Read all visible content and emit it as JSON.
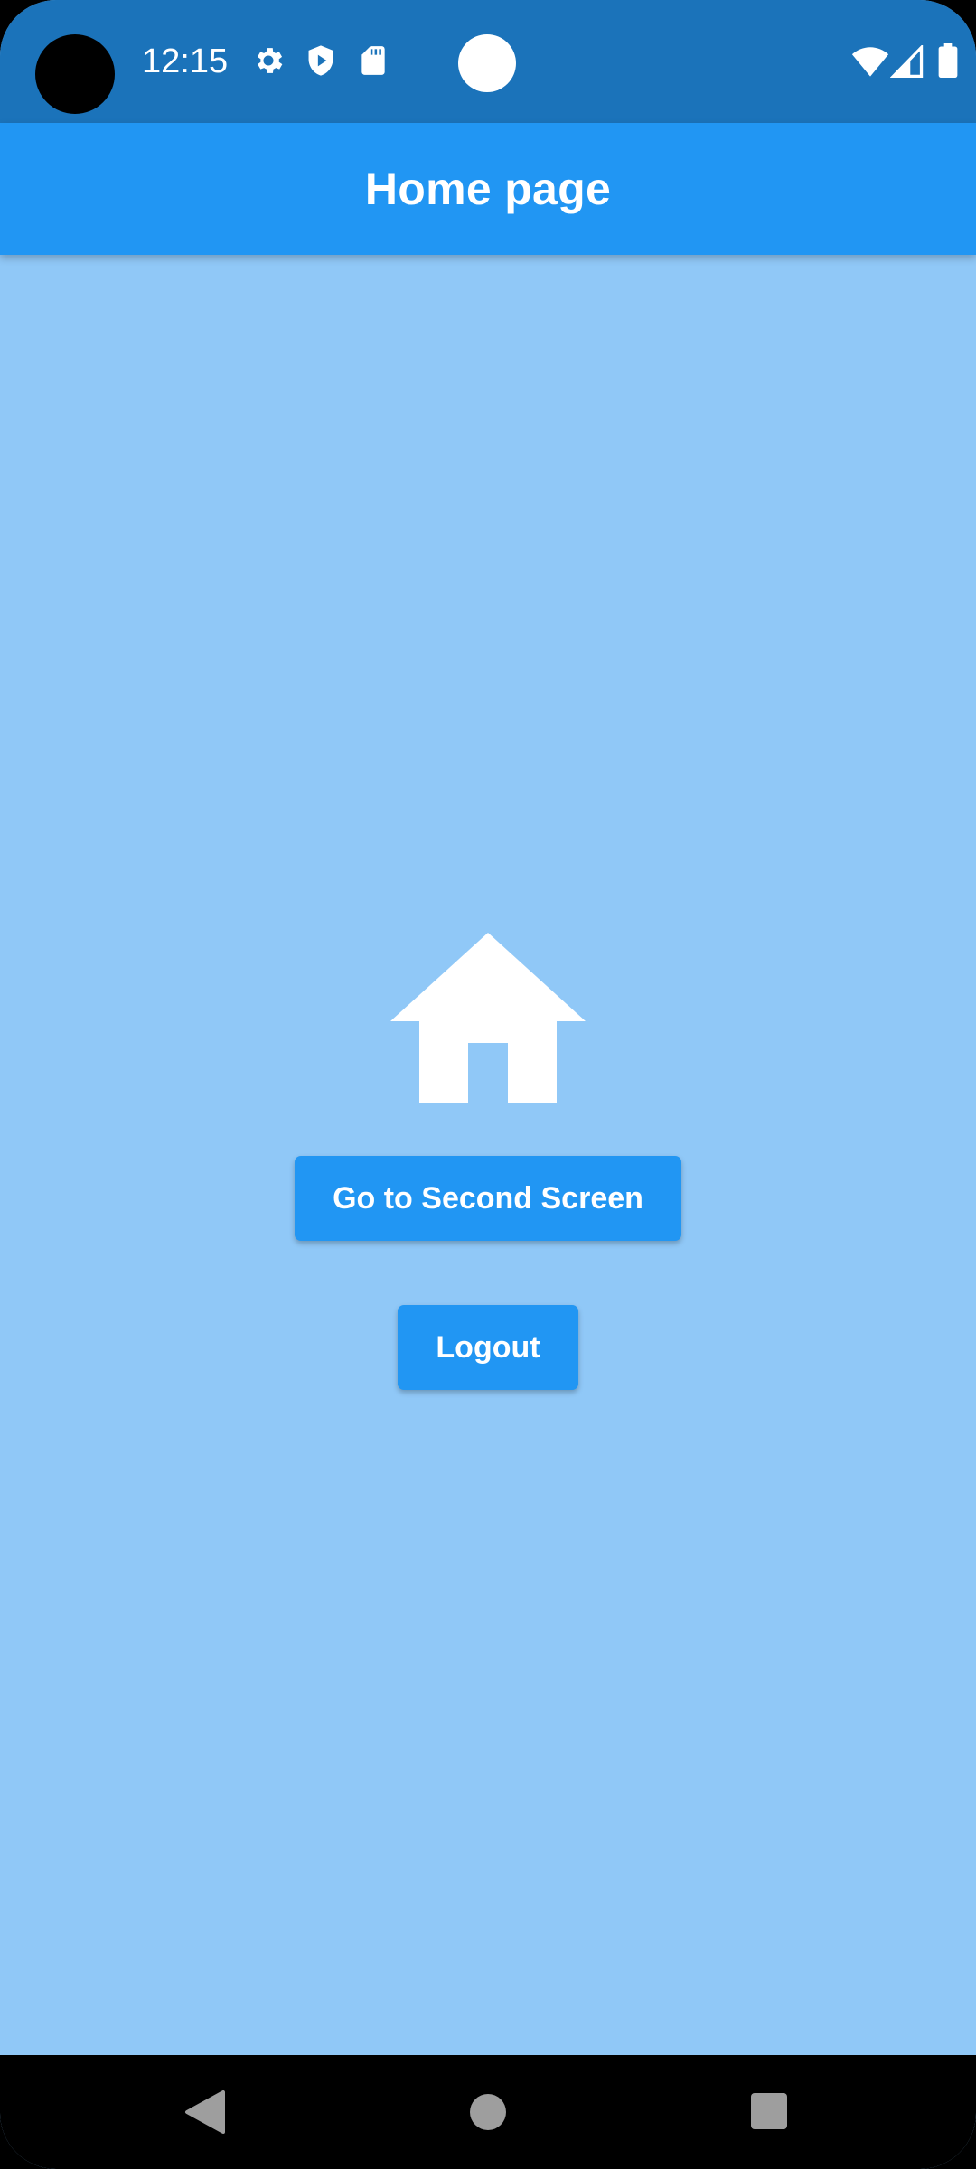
{
  "status_bar": {
    "time": "12:15",
    "left_icons": [
      "gear-icon",
      "shield-play-icon",
      "sd-card-icon"
    ],
    "right_icons": [
      "wifi-icon",
      "cell-signal-icon",
      "battery-icon"
    ]
  },
  "app_bar": {
    "title": "Home page",
    "color": "#2196F3"
  },
  "body": {
    "background": "#90C8F7",
    "icon": "home-icon",
    "buttons": {
      "second_screen": "Go to Second Screen",
      "logout": "Logout"
    }
  },
  "nav_bar": {
    "items": [
      "back-icon",
      "home-circle-icon",
      "recents-square-icon"
    ]
  }
}
